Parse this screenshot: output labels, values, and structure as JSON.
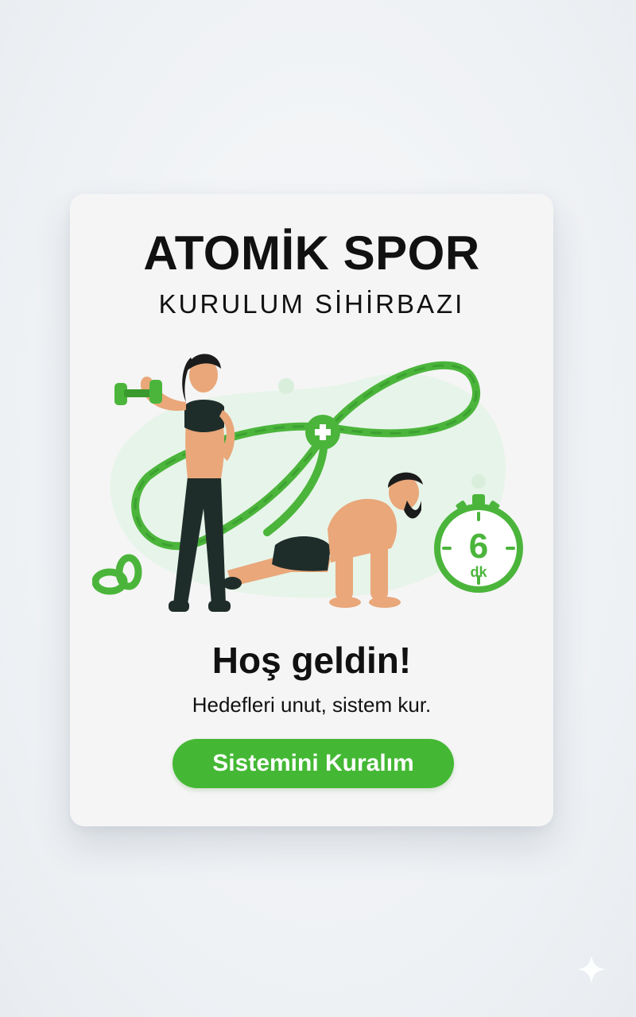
{
  "app": {
    "title": "ATOMİK SPOR",
    "subtitle": "KURULUM SİHİRBAZI"
  },
  "illustration": {
    "timer_value": "6",
    "timer_unit": "dk",
    "icons": [
      "dumbbell-icon",
      "chain-icon",
      "plus-icon",
      "stopwatch-icon"
    ]
  },
  "welcome": {
    "heading": "Hoş geldin!",
    "tagline": "Hedefleri unut, sistem kur."
  },
  "cta": {
    "label": "Sistemini Kuralım"
  },
  "colors": {
    "accent": "#44b834",
    "card_bg": "#f5f5f5",
    "page_bg": "#eef1f4",
    "text": "#111111"
  }
}
